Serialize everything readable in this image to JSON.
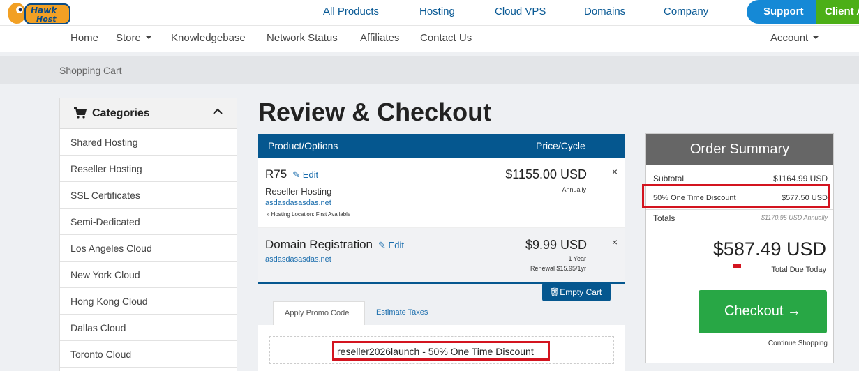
{
  "brand": {
    "logo_text": "Hawk Host"
  },
  "topnav": {
    "items": [
      "All Products",
      "Hosting",
      "Cloud VPS",
      "Domains",
      "Company"
    ],
    "support": "Support",
    "client": "Client A"
  },
  "subnav": {
    "items": [
      "Home",
      "Store",
      "Knowledgebase",
      "Network Status",
      "Affiliates",
      "Contact Us"
    ],
    "account": "Account"
  },
  "breadcrumb": "Shopping Cart",
  "sidebar": {
    "title": "Categories",
    "items": [
      "Shared Hosting",
      "Reseller Hosting",
      "SSL Certificates",
      "Semi-Dedicated",
      "Los Angeles Cloud",
      "New York Cloud",
      "Hong Kong Cloud",
      "Dallas Cloud",
      "Toronto Cloud"
    ]
  },
  "main": {
    "title": "Review & Checkout",
    "columns": {
      "product": "Product/Options",
      "price": "Price/Cycle"
    },
    "items": [
      {
        "name": "R75",
        "edit": "Edit",
        "group": "Reseller Hosting",
        "domain": "asdasdasasdas.net",
        "option": "» Hosting Location: First Available",
        "price": "$1155.00 USD",
        "cycle": "Annually",
        "remove": "×"
      },
      {
        "name": "Domain Registration",
        "edit": "Edit",
        "domain": "asdasdasasdas.net",
        "price": "$9.99 USD",
        "cycle": "1 Year",
        "renewal": "Renewal $15.95/1yr",
        "remove": "×"
      }
    ],
    "empty_cart": "Empty Cart",
    "tabs": [
      "Apply Promo Code",
      "Estimate Taxes"
    ],
    "promo_applied": "reseller2026launch - 50% One Time Discount"
  },
  "summary": {
    "title": "Order Summary",
    "subtotal_label": "Subtotal",
    "subtotal": "$1164.99 USD",
    "discount_label": "50% One Time Discount",
    "discount": "$577.50 USD",
    "totals_label": "Totals",
    "totals": "$1170.95 USD Annually",
    "total_due": "$587.49 USD",
    "total_due_label": "Total Due Today",
    "checkout": "Checkout →",
    "continue": "Continue Shopping"
  },
  "colors": {
    "primary": "#05578f",
    "support": "#1589d6",
    "client": "#4caf17",
    "checkout": "#28a745",
    "highlight": "#d3141f"
  }
}
